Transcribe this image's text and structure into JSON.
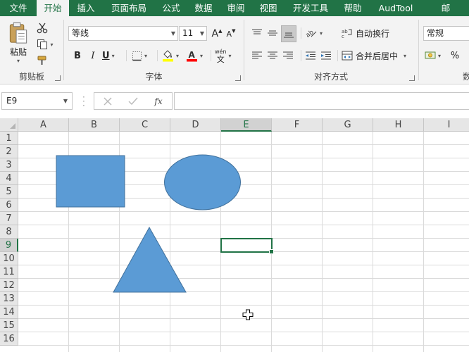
{
  "tabs": [
    {
      "label": "文件",
      "active": false
    },
    {
      "label": "开始",
      "active": true
    },
    {
      "label": "插入",
      "active": false
    },
    {
      "label": "页面布局",
      "active": false
    },
    {
      "label": "公式",
      "active": false
    },
    {
      "label": "数据",
      "active": false
    },
    {
      "label": "审阅",
      "active": false
    },
    {
      "label": "视图",
      "active": false
    },
    {
      "label": "开发工具",
      "active": false
    },
    {
      "label": "帮助",
      "active": false
    },
    {
      "label": "AudTool",
      "active": false
    },
    {
      "label": "邮",
      "active": false
    }
  ],
  "clipboard": {
    "paste_label": "粘贴",
    "group_label": "剪贴板"
  },
  "font": {
    "name": "等线",
    "size": "11",
    "bold": "B",
    "italic": "I",
    "underline": "U",
    "grow": "A",
    "shrink": "A",
    "wen_top": "wén",
    "wen_bottom": "文",
    "group_label": "字体",
    "fill_color": "#ffff00",
    "font_color": "#ff0000"
  },
  "alignment": {
    "wrap_label": "自动换行",
    "merge_label": "合并后居中",
    "group_label": "对齐方式"
  },
  "number": {
    "format": "常规",
    "percent": "%",
    "group_label": "数字"
  },
  "formula_bar": {
    "name_box": "E9",
    "formula": "",
    "fx": "fx"
  },
  "grid": {
    "columns": [
      "A",
      "B",
      "C",
      "D",
      "E",
      "F",
      "G",
      "H",
      "I"
    ],
    "rows": [
      "1",
      "2",
      "3",
      "4",
      "5",
      "6",
      "7",
      "8",
      "9",
      "10",
      "11",
      "12",
      "13",
      "14",
      "15",
      "16"
    ],
    "selected_column": "E",
    "selected_row": "9",
    "shape_fill": "#5b9bd5",
    "shape_stroke": "#41719c",
    "accent": "#217346"
  }
}
